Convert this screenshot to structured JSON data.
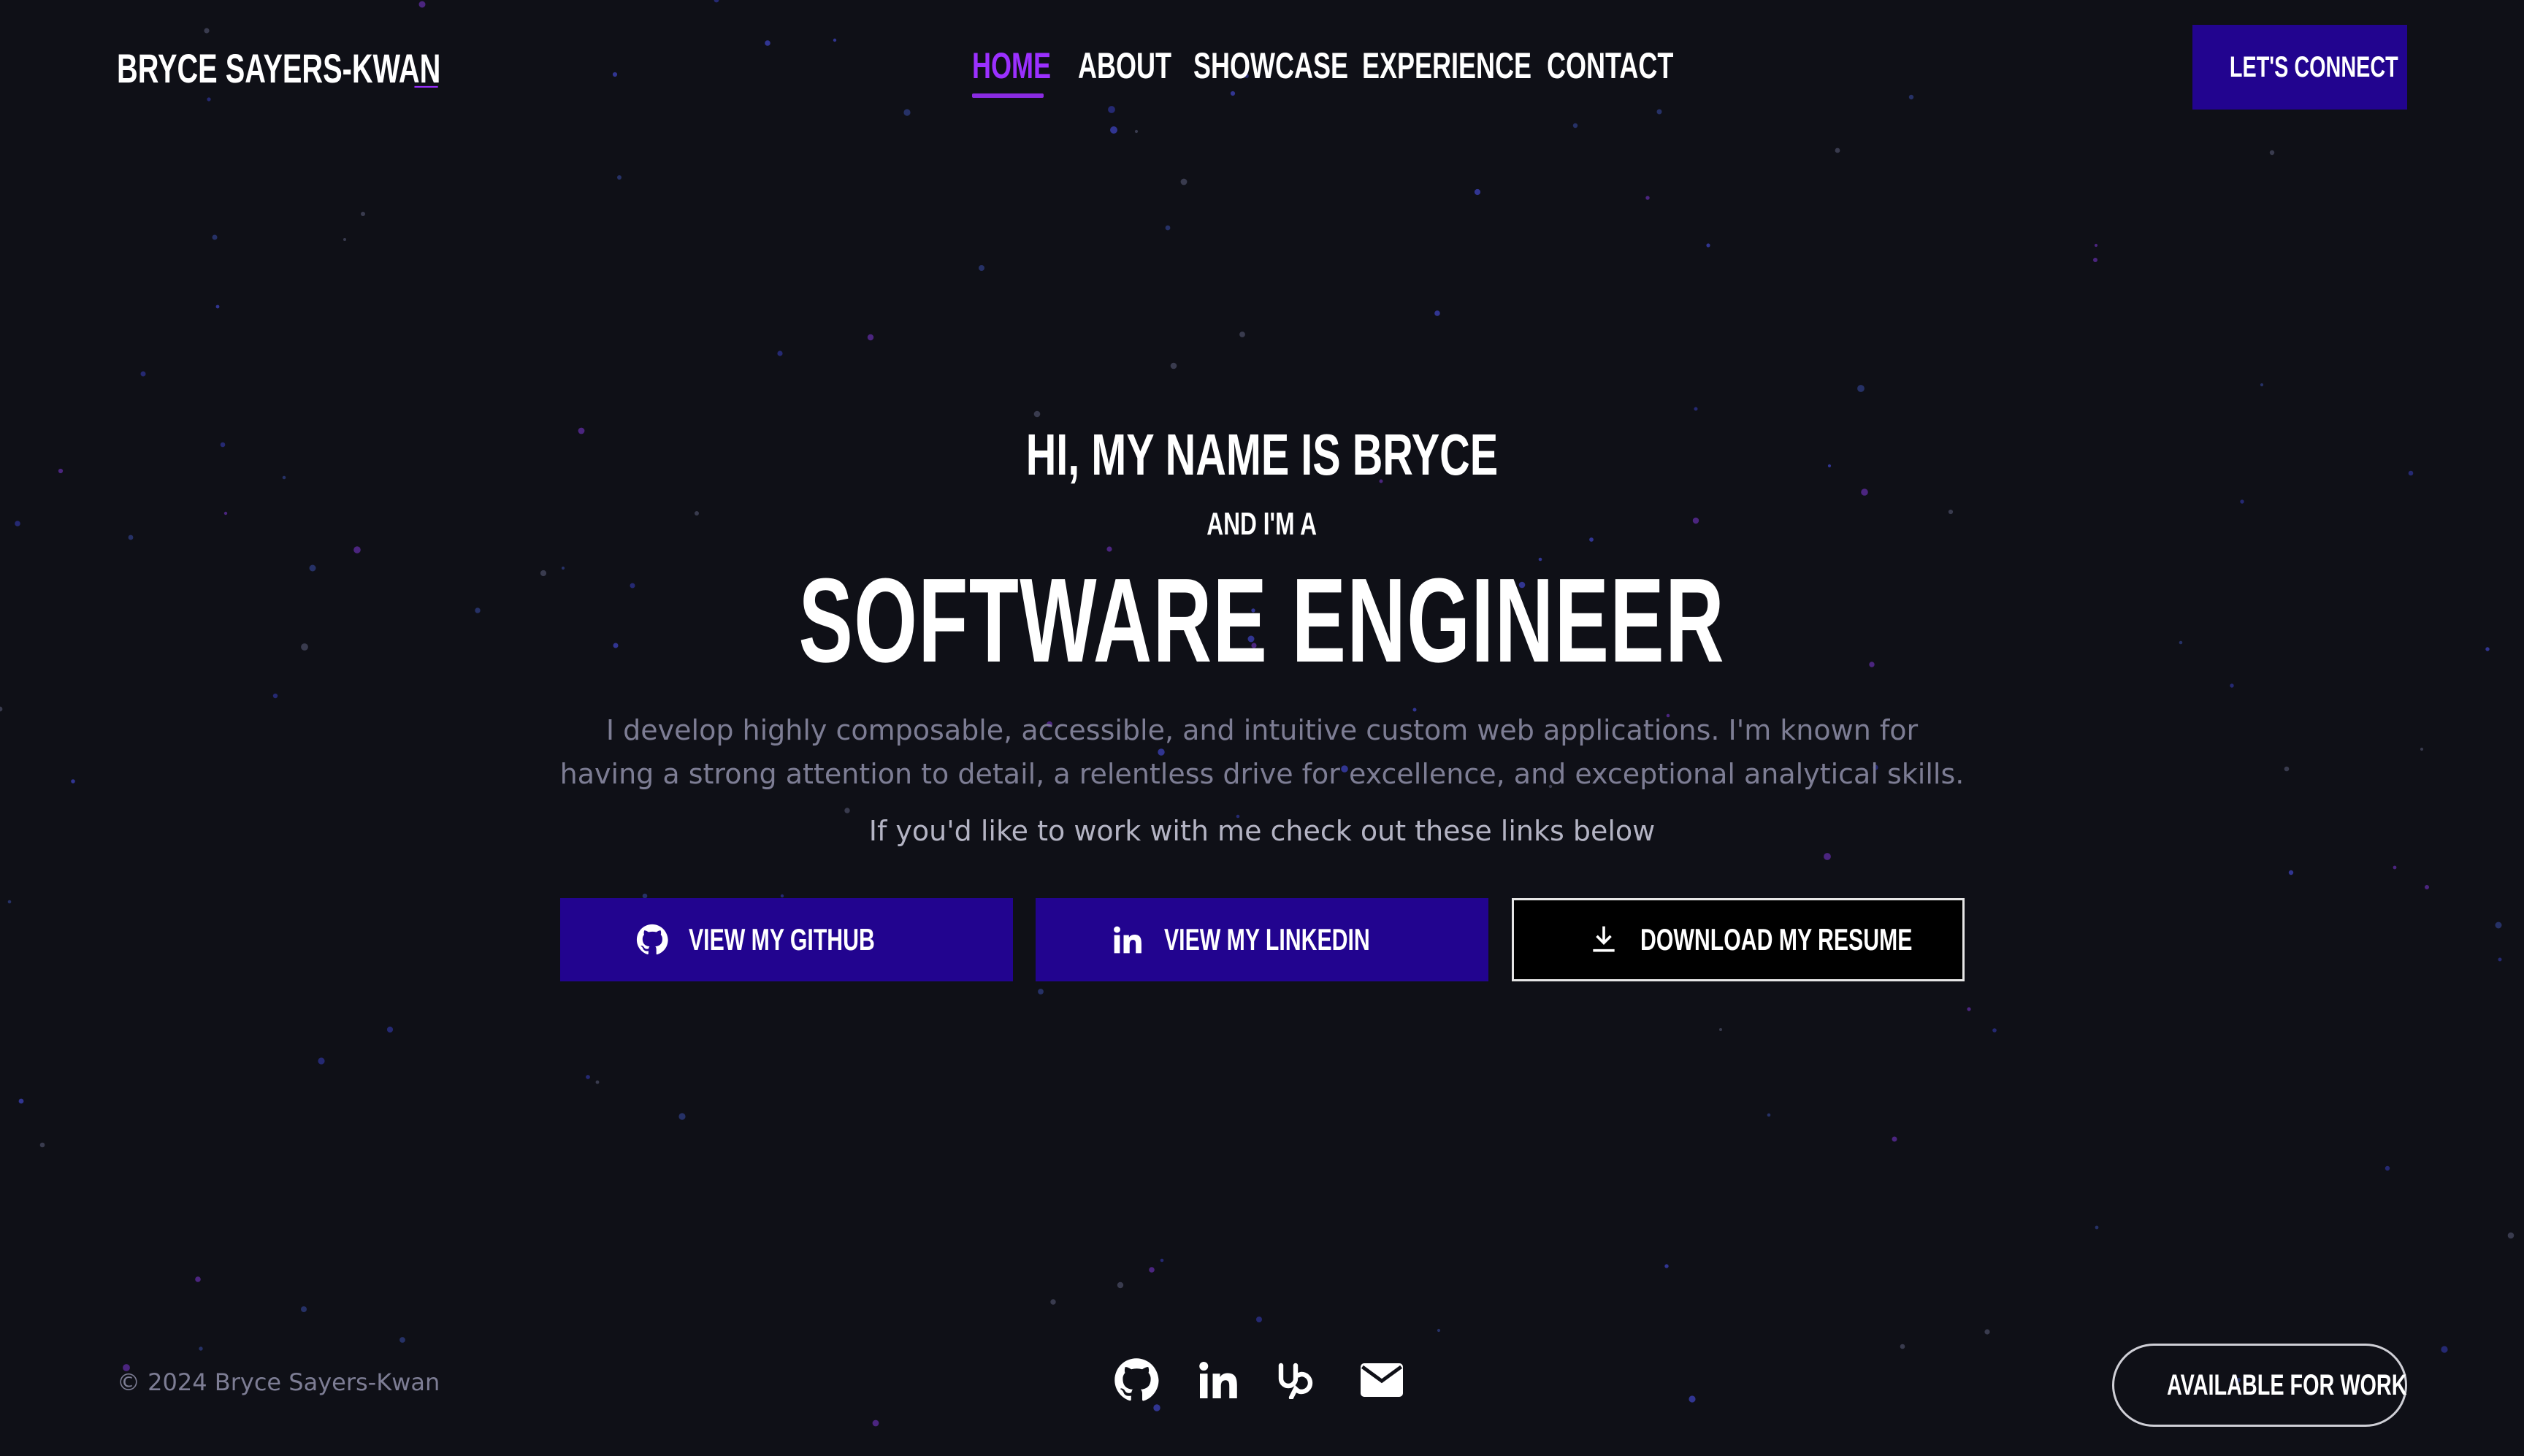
{
  "header": {
    "logo": "BRYCE SAYERS-KWAN",
    "logo_cursor": "_",
    "nav": [
      {
        "label": "HOME",
        "active": true
      },
      {
        "label": "ABOUT",
        "active": false
      },
      {
        "label": "SHOWCASE",
        "active": false
      },
      {
        "label": "EXPERIENCE",
        "active": false
      },
      {
        "label": "CONTACT",
        "active": false
      }
    ],
    "connect_label": "LET'S CONNECT"
  },
  "hero": {
    "greeting": "HI, MY NAME IS BRYCE",
    "subgreeting": "AND I'M A",
    "role": "SOFTWARE ENGINEER",
    "description": "I develop highly composable, accessible, and intuitive custom web applications. I'm known for having a strong attention to detail, a relentless drive for excellence, and exceptional analytical skills.",
    "cta": "If you'd like to work with me check out these links below",
    "buttons": {
      "github": {
        "label": "VIEW MY GITHUB",
        "icon": "github-icon"
      },
      "linkedin": {
        "label": "VIEW MY LINKEDIN",
        "icon": "linkedin-icon"
      },
      "resume": {
        "label": "DOWNLOAD MY RESUME",
        "icon": "download-icon"
      }
    }
  },
  "footer": {
    "copyright": "© 2024 Bryce Sayers-Kwan",
    "social_icons": [
      "github-icon",
      "linkedin-icon",
      "upwork-icon",
      "mail-icon"
    ],
    "status": "AVAILABLE FOR WORK"
  },
  "colors": {
    "background": "#0f1017",
    "accent": "#9b30ff",
    "button": "#22048f",
    "status_dot": "#3fbf3f",
    "muted_text": "#7d7d94"
  }
}
